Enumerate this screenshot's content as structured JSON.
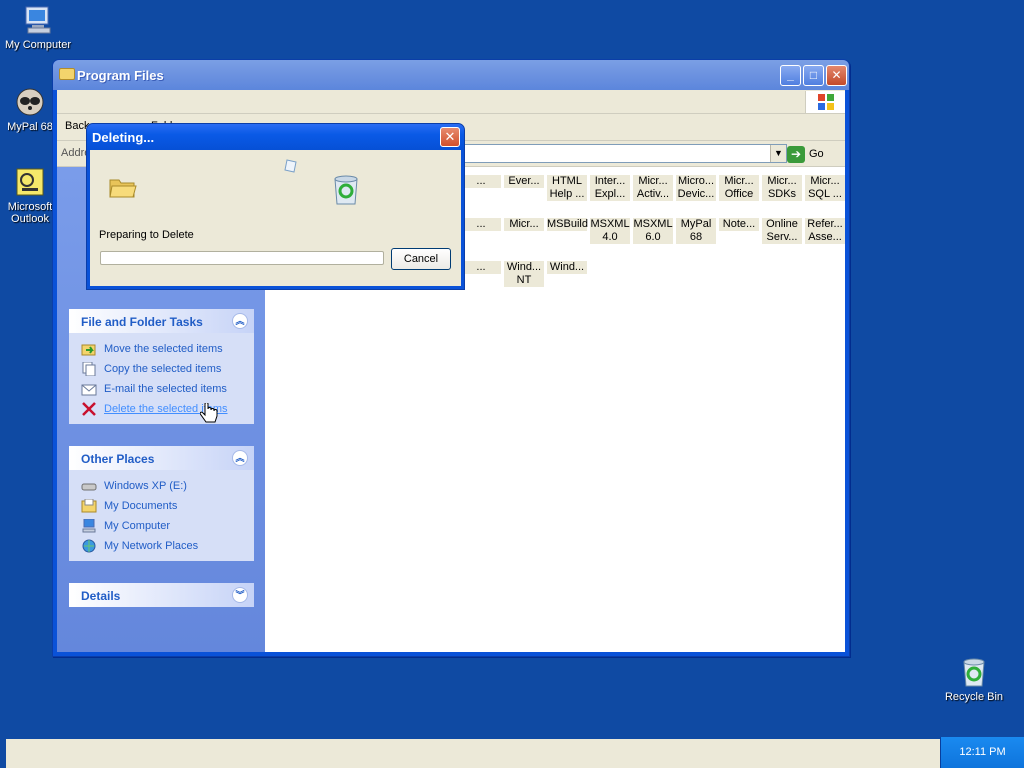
{
  "desktop": {
    "icons": [
      {
        "label": "My Computer",
        "icon": "my-computer-icon"
      },
      {
        "label": "MyPal 68",
        "icon": "mypal-icon"
      },
      {
        "label": "Microsoft Outlook",
        "icon": "outlook-icon"
      },
      {
        "label": "Recycle Bin",
        "icon": "recycle-bin-icon"
      }
    ]
  },
  "explorer": {
    "title": "Program Files",
    "toolbar": {
      "back": "Back",
      "folders": "Folders"
    },
    "address": {
      "label": "Address",
      "value": ""
    },
    "go_label": "Go",
    "file_tasks": {
      "header": "File and Folder Tasks",
      "items": [
        {
          "label": "Move the selected items",
          "icon": "move-icon"
        },
        {
          "label": "Copy the selected items",
          "icon": "copy-icon"
        },
        {
          "label": "E-mail the selected items",
          "icon": "email-icon"
        },
        {
          "label": "Delete the selected items",
          "icon": "delete-icon"
        }
      ]
    },
    "other_places": {
      "header": "Other Places",
      "items": [
        {
          "label": "Windows XP (E:)",
          "icon": "drive-icon"
        },
        {
          "label": "My Documents",
          "icon": "my-documents-icon"
        },
        {
          "label": "My Computer",
          "icon": "my-computer-icon"
        },
        {
          "label": "My Network Places",
          "icon": "network-places-icon"
        }
      ]
    },
    "details": {
      "header": "Details"
    },
    "files_row1": [
      "...",
      "Ever...",
      "HTML Help ...",
      "Inter... Expl...",
      "Micr... Activ...",
      "Micro... Devic...",
      "Micr... Office",
      "Micr... SDKs",
      "Micr... SQL ..."
    ],
    "files_row2": [
      "...",
      "Micr...",
      "MSBuild",
      "MSXML 4.0",
      "MSXML 6.0",
      "MyPal 68",
      "Note...",
      "Online Serv...",
      "Refer... Asse..."
    ],
    "files_row3": [
      "...",
      "Wind... NT",
      "Wind..."
    ]
  },
  "dialog": {
    "title": "Deleting...",
    "status": "Preparing to Delete",
    "cancel": "Cancel",
    "progress": 0
  },
  "taskbar": {
    "clock": "12:11 PM"
  }
}
